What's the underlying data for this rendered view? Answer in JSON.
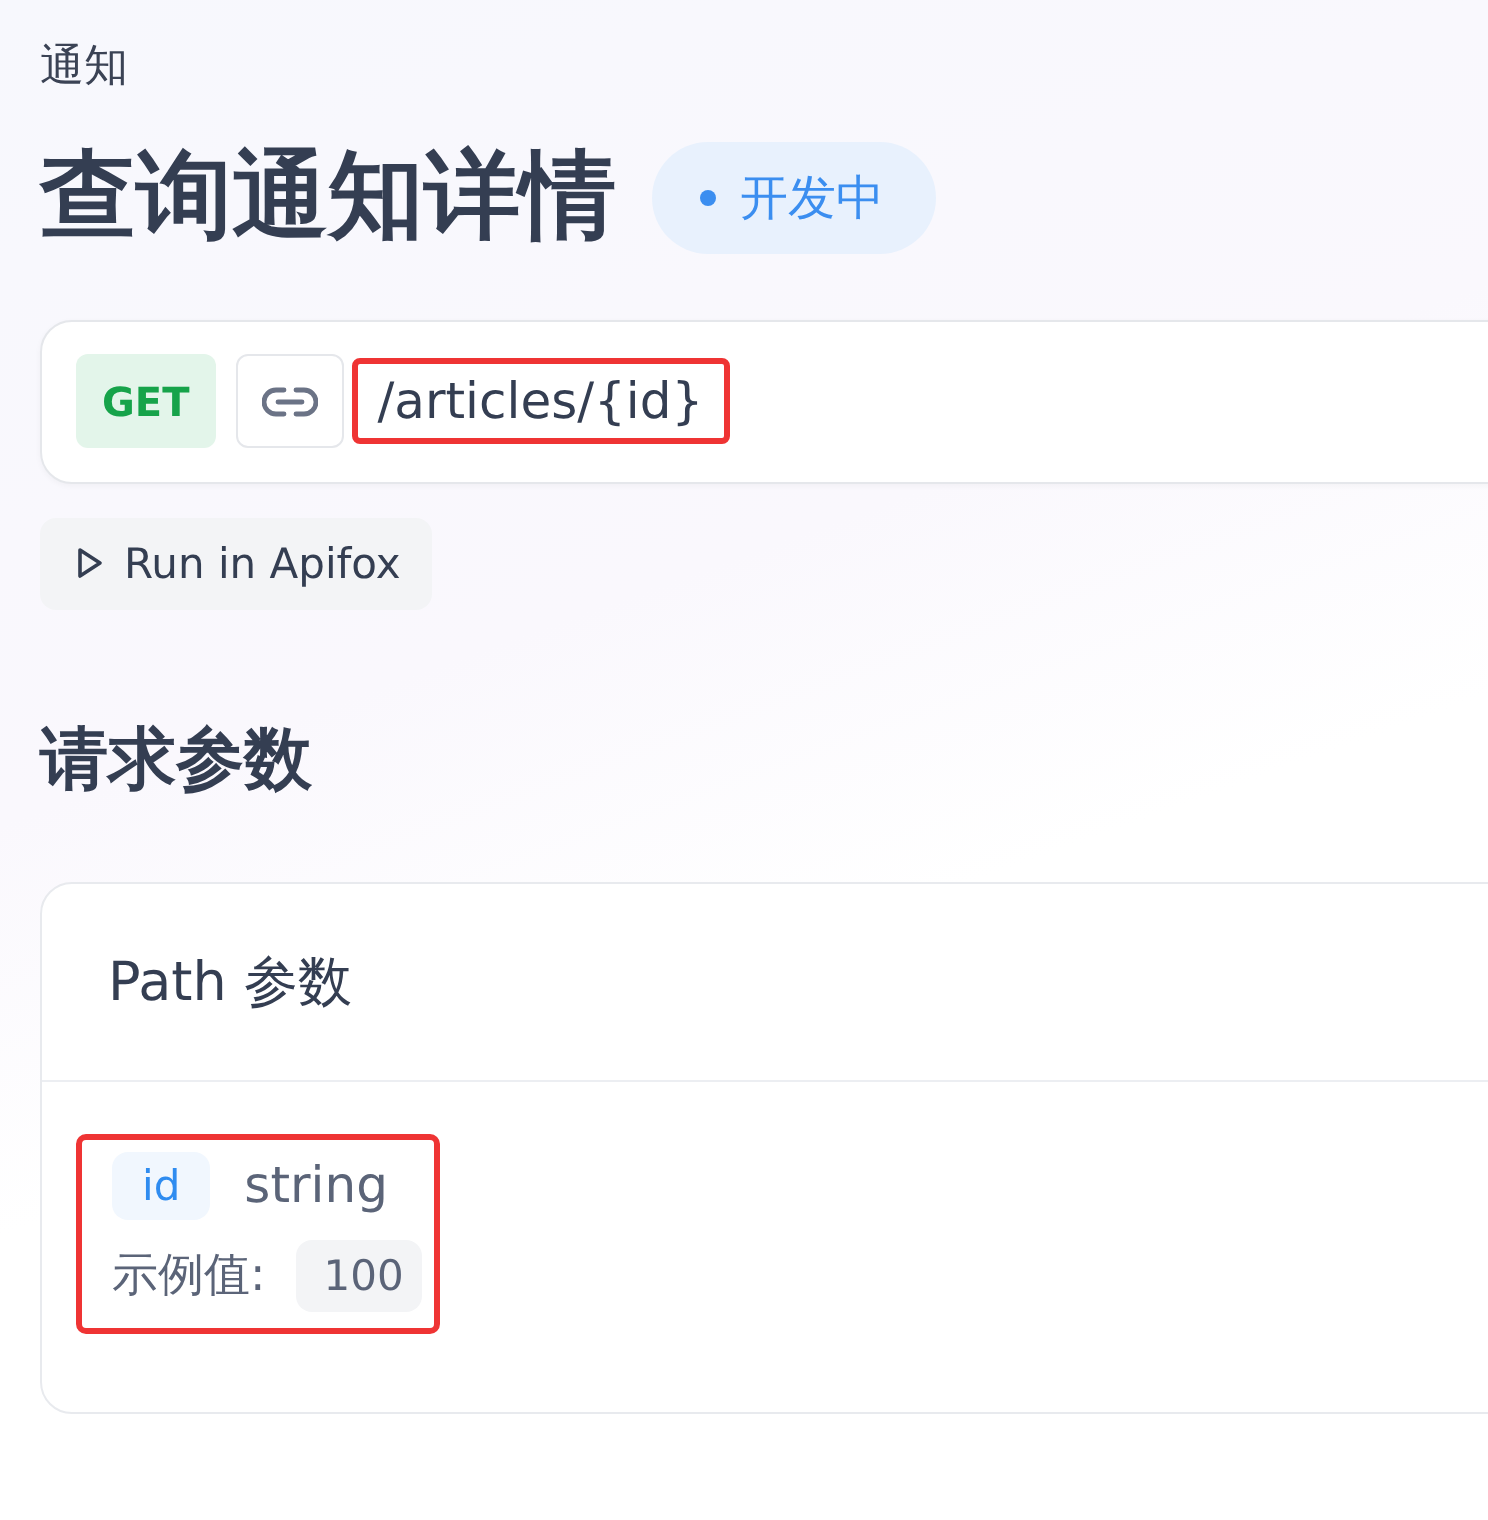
{
  "breadcrumb": "通知",
  "title": "查询通知详情",
  "status": {
    "label": "开发中"
  },
  "request": {
    "method": "GET",
    "path": "/articles/{id}",
    "highlighted": true
  },
  "run_button": "Run in Apifox",
  "section_title": "请求参数",
  "params_card": {
    "title": "Path 参数",
    "params": [
      {
        "name": "id",
        "type": "string",
        "example_label": "示例值:",
        "example": "100",
        "highlighted": true
      }
    ]
  }
}
